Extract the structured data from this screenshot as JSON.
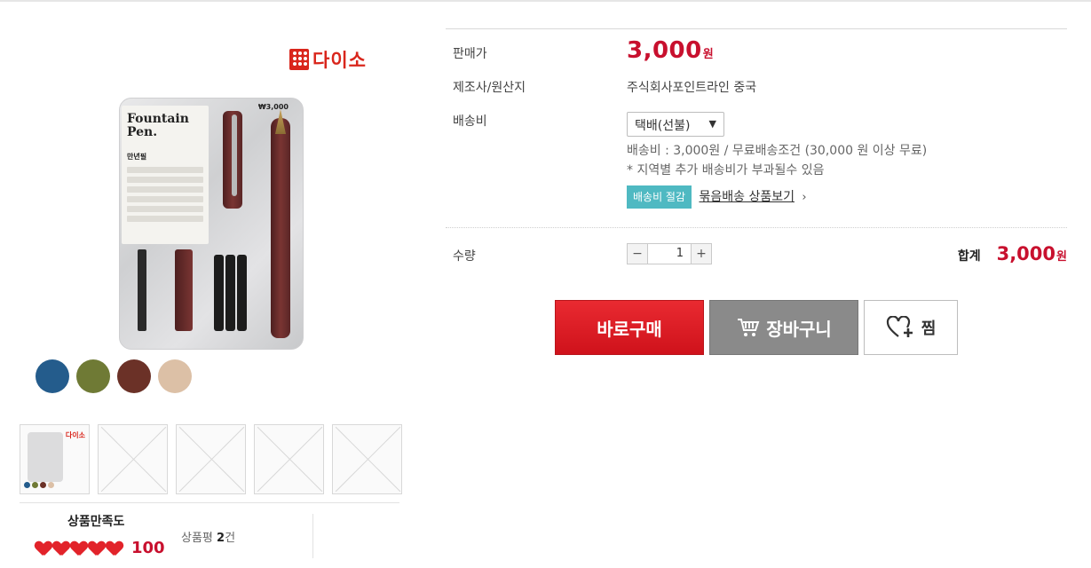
{
  "brand": {
    "name": "다이소",
    "mark_text": "daiso",
    "color": "#d9261c"
  },
  "product_image": {
    "card_title": "Fountain Pen.",
    "card_subtitle": "만년필",
    "price_tag": "₩3,000"
  },
  "swatches": [
    "#245c8c",
    "#6f7a35",
    "#6b3127",
    "#dcc0a6"
  ],
  "thumbnails": {
    "count": 5,
    "selected": 0
  },
  "rating": {
    "title": "상품만족도",
    "hearts": 5,
    "score": "100",
    "reviews_prefix": "상품평",
    "reviews_count": "2",
    "reviews_suffix": "건"
  },
  "info": {
    "price_label": "판매가",
    "price": "3,000",
    "currency": "원",
    "maker_label": "제조사/원산지",
    "maker_value": "주식회사포인트라인 중국",
    "shipping_label": "배송비",
    "shipping_select": "택배(선불)",
    "shipping_fee_line": "배송비 : 3,000원 / 무료배송조건 (30,000 원 이상 무료)",
    "shipping_extra_line": "* 지역별 추가 배송비가 부과될수 있음",
    "badge": "배송비 절감",
    "bundle_link": "묶음배송 상품보기",
    "qty_label": "수량",
    "qty_value": "1",
    "total_label": "합계",
    "total_price": "3,000",
    "total_currency": "원"
  },
  "actions": {
    "buy": "바로구매",
    "cart": "장바구니",
    "wish": "찜"
  },
  "colors": {
    "accent_red": "#c8102e",
    "badge_teal": "#4fb9c2"
  }
}
